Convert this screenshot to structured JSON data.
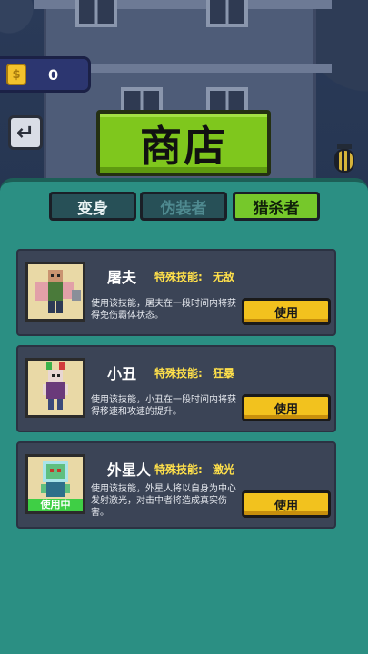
{
  "header": {
    "coin_symbol": "$",
    "coin_count": "0",
    "back_icon": "back-arrow-icon",
    "title": "商店"
  },
  "tabs": [
    {
      "label": "变身",
      "state": "normal"
    },
    {
      "label": "伪装者",
      "state": "disabled"
    },
    {
      "label": "猎杀者",
      "state": "selected"
    }
  ],
  "cards": [
    {
      "name": "屠夫",
      "skill_label": "特殊技能:",
      "skill_value": "无敌",
      "description": "使用该技能，屠夫在一段时间内将获得免伤霸体状态。",
      "button_label": "使用",
      "badge": ""
    },
    {
      "name": "小丑",
      "skill_label": "特殊技能:",
      "skill_value": "狂暴",
      "description": "使用该技能，小丑在一段时间内将获得移速和攻速的提升。",
      "button_label": "使用",
      "badge": ""
    },
    {
      "name": "外星人",
      "skill_label": "特殊技能:",
      "skill_value": "激光",
      "description": "使用该技能，外星人将以自身为中心发射激光，对击中者将造成真实伤害。",
      "button_label": "使用",
      "badge": "使用中"
    }
  ],
  "colors": {
    "panel": "#2b8f83",
    "accent_green": "#7fc71d",
    "button_yellow": "#f2c21e",
    "skill_text": "#ffe04a"
  }
}
